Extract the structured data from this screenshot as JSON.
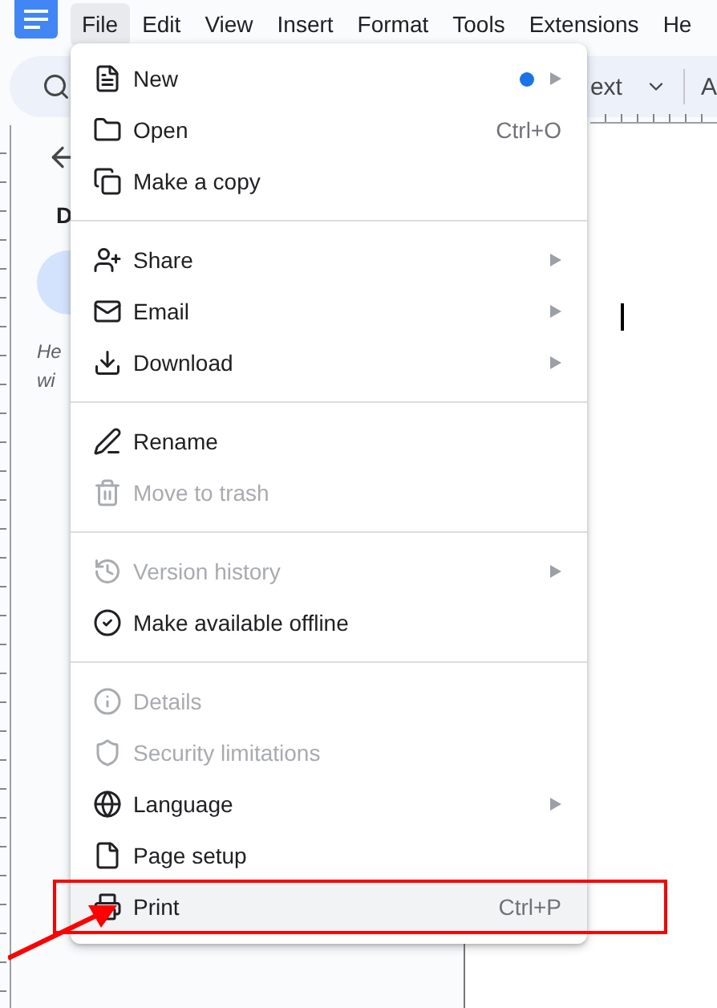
{
  "menu_bar": {
    "menus": [
      {
        "label": "File",
        "selected": true
      },
      {
        "label": "Edit",
        "selected": false
      },
      {
        "label": "View",
        "selected": false
      },
      {
        "label": "Insert",
        "selected": false
      },
      {
        "label": "Format",
        "selected": false
      },
      {
        "label": "Tools",
        "selected": false
      },
      {
        "label": "Extensions",
        "selected": false
      },
      {
        "label": "He",
        "selected": false
      }
    ]
  },
  "toolbar": {
    "style_dropdown": "ext",
    "font_label": "A"
  },
  "sidebar": {
    "heading": "D",
    "hint_lines": [
      "He",
      "wi"
    ]
  },
  "file_menu": {
    "items": [
      {
        "kind": "item",
        "label": "New",
        "unread_dot": true,
        "submenu": true,
        "disabled": false,
        "selected": false
      },
      {
        "kind": "item",
        "label": "Open",
        "shortcut": "Ctrl+O",
        "submenu": false,
        "disabled": false,
        "selected": false
      },
      {
        "kind": "item",
        "label": "Make a copy",
        "submenu": false,
        "disabled": false,
        "selected": false
      },
      {
        "kind": "divider"
      },
      {
        "kind": "item",
        "label": "Share",
        "submenu": true,
        "disabled": false,
        "selected": false
      },
      {
        "kind": "item",
        "label": "Email",
        "submenu": true,
        "disabled": false,
        "selected": false
      },
      {
        "kind": "item",
        "label": "Download",
        "submenu": true,
        "disabled": false,
        "selected": false
      },
      {
        "kind": "divider"
      },
      {
        "kind": "item",
        "label": "Rename",
        "submenu": false,
        "disabled": false,
        "selected": false
      },
      {
        "kind": "item",
        "label": "Move to trash",
        "submenu": false,
        "disabled": true,
        "selected": false
      },
      {
        "kind": "divider"
      },
      {
        "kind": "item",
        "label": "Version history",
        "submenu": true,
        "disabled": true,
        "selected": false
      },
      {
        "kind": "item",
        "label": "Make available offline",
        "submenu": false,
        "disabled": false,
        "selected": false
      },
      {
        "kind": "divider"
      },
      {
        "kind": "item",
        "label": "Details",
        "submenu": false,
        "disabled": true,
        "selected": false
      },
      {
        "kind": "item",
        "label": "Security limitations",
        "submenu": false,
        "disabled": true,
        "selected": false
      },
      {
        "kind": "item",
        "label": "Language",
        "submenu": true,
        "disabled": false,
        "selected": false
      },
      {
        "kind": "item",
        "label": "Page setup",
        "submenu": false,
        "disabled": false,
        "selected": false
      },
      {
        "kind": "item",
        "label": "Print",
        "shortcut": "Ctrl+P",
        "submenu": false,
        "disabled": false,
        "selected": true
      }
    ]
  },
  "annotation": {
    "kind": "box-and-arrow"
  }
}
